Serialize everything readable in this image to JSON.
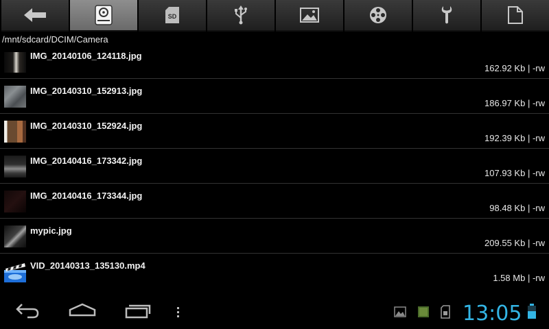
{
  "toolbar": {
    "buttons": [
      {
        "icon": "back-arrow-icon",
        "active": false
      },
      {
        "icon": "internal-storage-icon",
        "active": true
      },
      {
        "icon": "sd-card-icon",
        "active": false
      },
      {
        "icon": "usb-icon",
        "active": false
      },
      {
        "icon": "picture-icon",
        "active": false
      },
      {
        "icon": "film-reel-icon",
        "active": false
      },
      {
        "icon": "wrench-icon",
        "active": false
      },
      {
        "icon": "document-icon",
        "active": false
      }
    ],
    "sd_label": "SD"
  },
  "path": "/mnt/sdcard/DCIM/Camera",
  "files": [
    {
      "name": "IMG_20140106_124118.jpg",
      "size": "162.92 Kb",
      "perms": "| -rw",
      "thumb": "dark-room"
    },
    {
      "name": "IMG_20140310_152913.jpg",
      "size": "186.97 Kb",
      "perms": "| -rw",
      "thumb": "wall"
    },
    {
      "name": "IMG_20140310_152924.jpg",
      "size": "192.39 Kb",
      "perms": "| -rw",
      "thumb": "brick"
    },
    {
      "name": "IMG_20140416_173342.jpg",
      "size": "107.93 Kb",
      "perms": "| -rw",
      "thumb": "street"
    },
    {
      "name": "IMG_20140416_173344.jpg",
      "size": "98.48 Kb",
      "perms": "| -rw",
      "thumb": "dim"
    },
    {
      "name": "mypic.jpg",
      "size": "209.55 Kb",
      "perms": "| -rw",
      "thumb": "night"
    },
    {
      "name": "VID_20140313_135130.mp4",
      "size": "1.58 Mb",
      "perms": "| -rw",
      "thumb": "video"
    }
  ],
  "status_bar": {
    "time": "13:05",
    "clock_color": "#33b5e5",
    "notifications": [
      "picture-icon",
      "app-icon",
      "sd-card-icon"
    ],
    "battery_color": "#33b5e5"
  },
  "nav_buttons": [
    "back-icon",
    "home-icon",
    "recent-apps-icon",
    "menu-icon"
  ]
}
